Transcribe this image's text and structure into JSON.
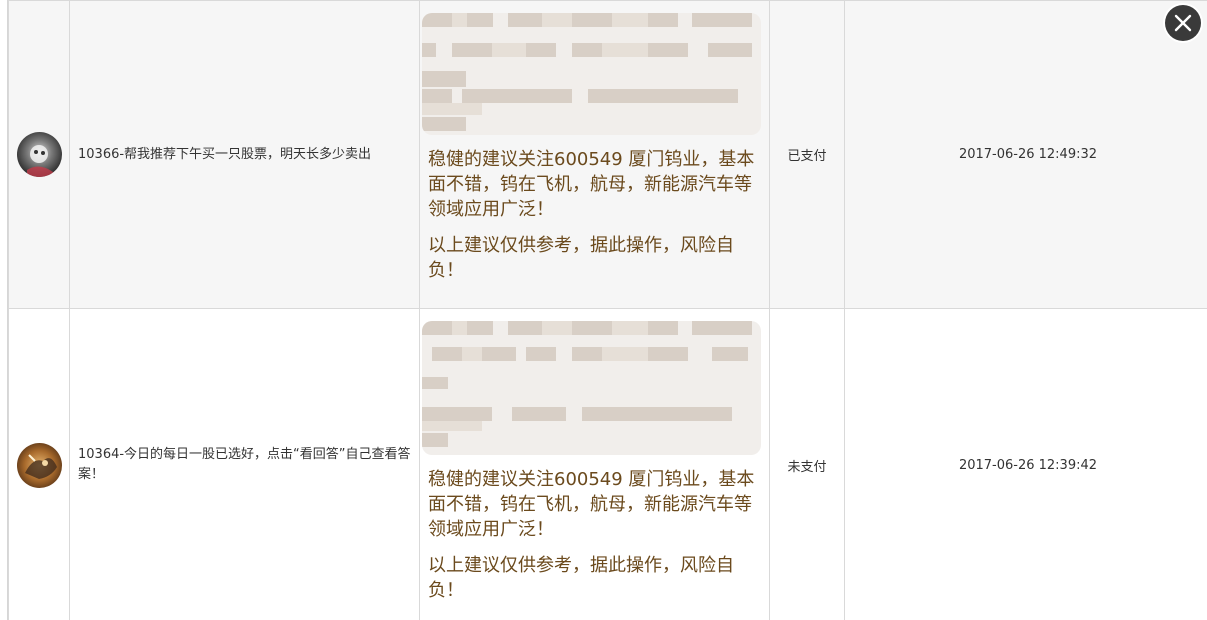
{
  "rows": [
    {
      "question": "10366-帮我推荐下午买一只股票，明天长多少卖出",
      "answer_paragraphs": [
        "稳健的建议关注600549 厦门钨业，基本面不错，钨在飞机，航母，新能源汽车等领域应用广泛！",
        "以上建议仅供参考，据此操作，风险自负！"
      ],
      "status": "已支付",
      "time": "2017-06-26 12:49:32"
    },
    {
      "question": "10364-今日的每日一股已选好，点击“看回答”自己查看答案！",
      "answer_paragraphs": [
        "稳健的建议关注600549 厦门钨业，基本面不错，钨在飞机，航母，新能源汽车等领域应用广泛！",
        "以上建议仅供参考，据此操作，风险自负！"
      ],
      "status": "未支付",
      "time": "2017-06-26 12:39:42"
    }
  ],
  "icons": {
    "close": "close-icon",
    "avatar_row1": "avatar-icon",
    "avatar_row2": "avatar-icon"
  },
  "colors": {
    "answer_text": "#6b4a1d",
    "close_button": "#3a3a3a",
    "row_alt_bg": "#f6f6f6",
    "border": "#d9d9d9"
  }
}
